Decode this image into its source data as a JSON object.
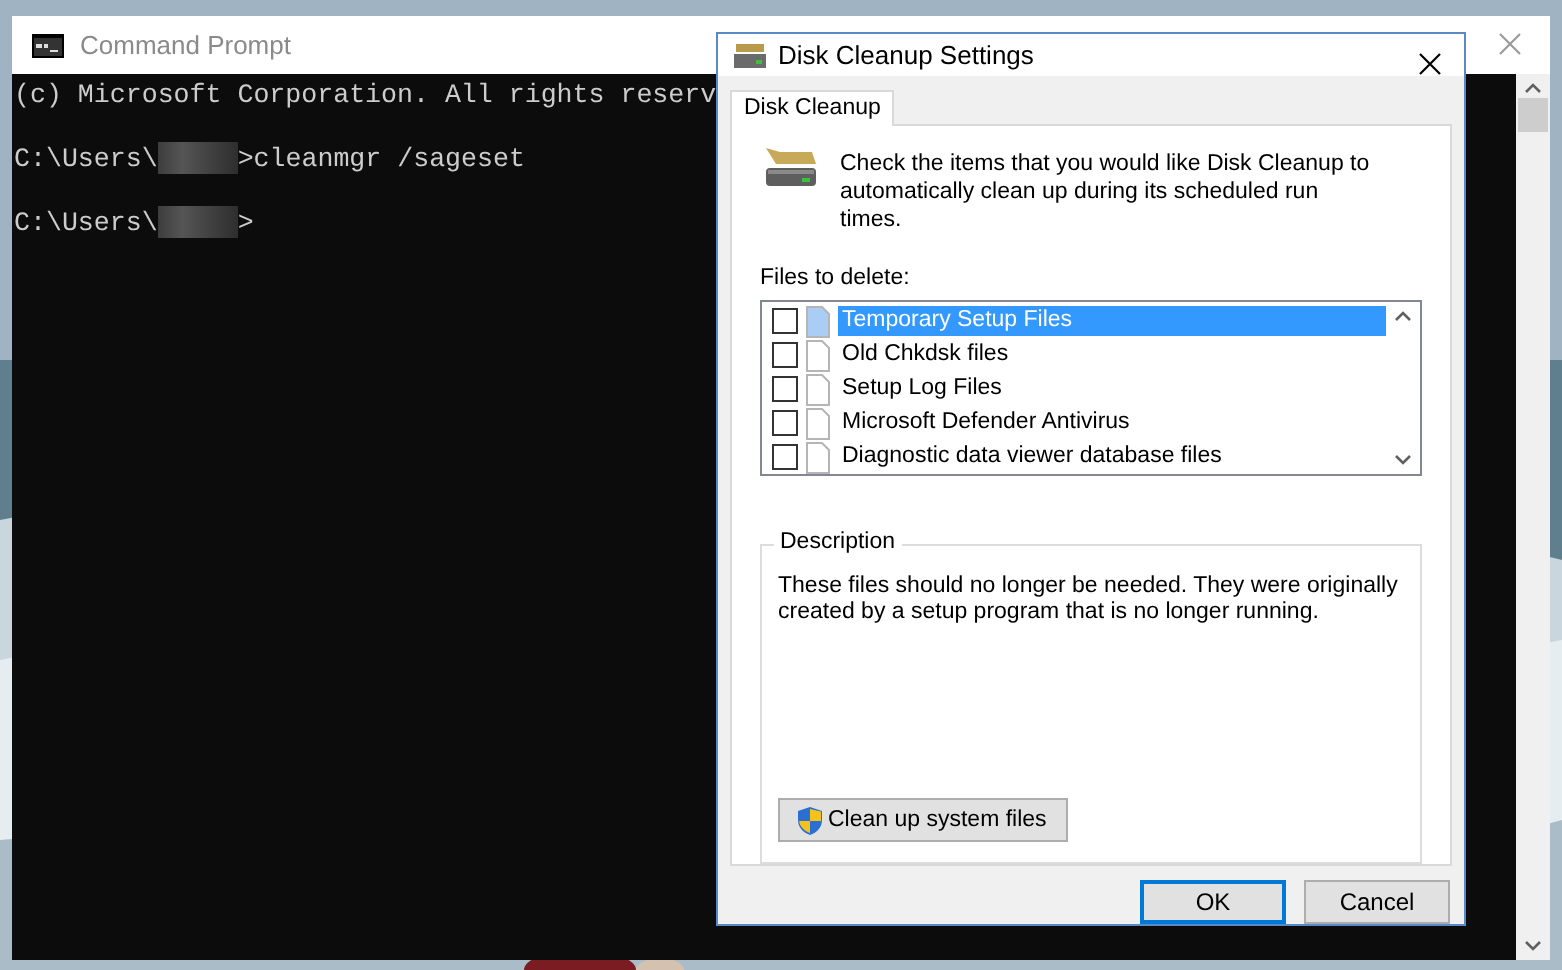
{
  "console": {
    "title": "Command Prompt",
    "lines": [
      [
        {
          "kind": "text",
          "text": "(c) Microsoft Corporation. All rights reserv"
        }
      ],
      [
        {
          "kind": "text",
          "text": "C:\\Users\\"
        },
        {
          "kind": "redacted"
        },
        {
          "kind": "text",
          "text": ">cleanmgr /sageset"
        }
      ],
      [
        {
          "kind": "text",
          "text": "C:\\Users\\"
        },
        {
          "kind": "redacted"
        },
        {
          "kind": "text",
          "text": ">"
        }
      ]
    ]
  },
  "dialog": {
    "title": "Disk Cleanup Settings",
    "tabs": [
      {
        "label": "Disk Cleanup",
        "selected": true
      }
    ],
    "intro": "Check the items that you would like Disk Cleanup to automatically clean up during its scheduled run times.",
    "files_label": "Files to delete:",
    "files": [
      {
        "label": "Temporary Setup Files",
        "checked": false,
        "selected": true
      },
      {
        "label": "Old Chkdsk files",
        "checked": false,
        "selected": false
      },
      {
        "label": "Setup Log Files",
        "checked": false,
        "selected": false
      },
      {
        "label": "Microsoft Defender Antivirus",
        "checked": false,
        "selected": false
      },
      {
        "label": "Diagnostic data viewer database files",
        "checked": false,
        "selected": false
      }
    ],
    "description": {
      "heading": "Description",
      "text": "These files should no longer be needed. They were originally created by a setup program that is no longer running."
    },
    "system_button": "Clean up system files",
    "buttons": [
      {
        "label": "OK",
        "focused": true
      },
      {
        "label": "Cancel",
        "focused": false
      }
    ]
  }
}
